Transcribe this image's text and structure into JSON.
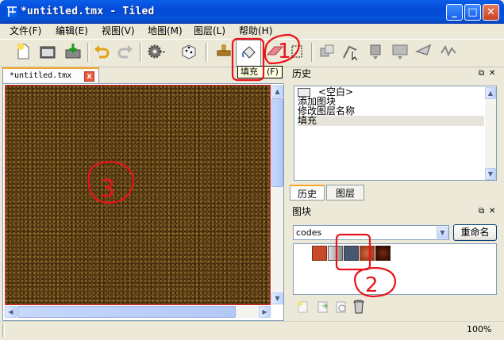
{
  "window": {
    "title": "*untitled.tmx - Tiled",
    "controls": [
      "_",
      "□",
      "✕"
    ]
  },
  "menu": [
    {
      "label": "文件(F)"
    },
    {
      "label": "编辑(E)"
    },
    {
      "label": "视图(V)"
    },
    {
      "label": "地图(M)"
    },
    {
      "label": "图层(L)"
    },
    {
      "label": "帮助(H)"
    }
  ],
  "toolbar": {
    "tooltip": "填充　(F)",
    "buttons": [
      "new",
      "open",
      "save",
      "undo",
      "redo",
      "settings",
      "random-dice",
      "stamp-brush",
      "bucket-fill",
      "eraser",
      "rect-select",
      "insert-tile",
      "edit-polygon",
      "insert-object",
      "image-layer",
      "insert-polygon",
      "insert-polyline"
    ]
  },
  "document_tab": {
    "label": "*untitled.tmx",
    "close": "x"
  },
  "history_panel": {
    "title": "历史",
    "items": [
      "<空白>",
      "添加图块",
      "修改图层名称",
      "填充"
    ],
    "selected_index": 3,
    "tabs": [
      "历史",
      "图层"
    ]
  },
  "tileset_panel": {
    "title": "图块",
    "combo_value": "codes",
    "rename_label": "重命名",
    "tile_colors": [
      "#c84a28",
      "#9a9a9a",
      "#4a5670",
      "#8a2a10",
      "#2a0a00"
    ]
  },
  "status": {
    "zoom": "100%"
  },
  "annotations": [
    "1",
    "2",
    "3"
  ]
}
